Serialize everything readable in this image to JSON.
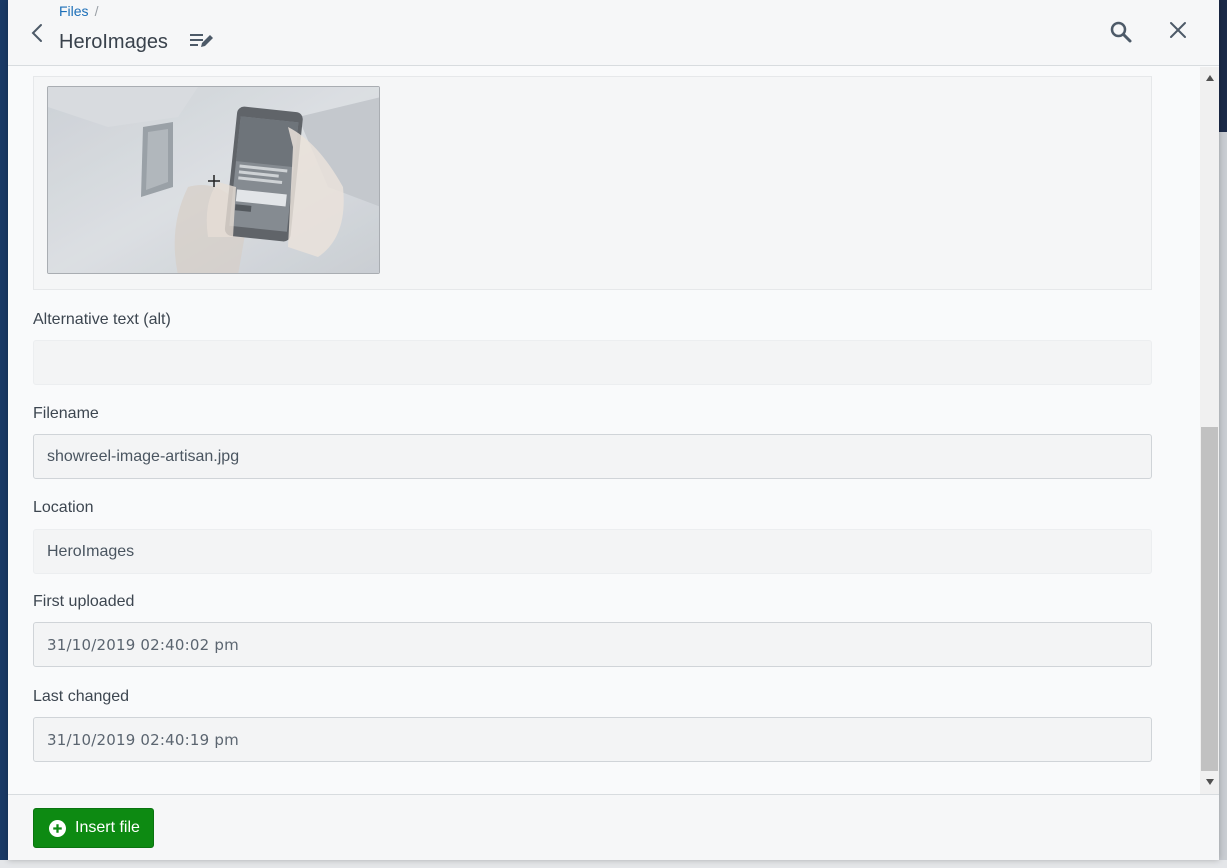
{
  "header": {
    "breadcrumb": "Files",
    "breadcrumb_separator": "/",
    "title": "HeroImages"
  },
  "preview": {
    "image_alt": "showreel-image-artisan.jpg preview"
  },
  "fields": {
    "alt": {
      "label": "Alternative text (alt)",
      "value": ""
    },
    "filename": {
      "label": "Filename",
      "value": "showreel-image-artisan.jpg"
    },
    "location": {
      "label": "Location",
      "value": "HeroImages"
    },
    "first_uploaded": {
      "label": "First uploaded",
      "value": "31/10/2019 02:40:02 pm"
    },
    "last_changed": {
      "label": "Last changed",
      "value": "31/10/2019 02:40:19 pm"
    }
  },
  "footer": {
    "insert_label": "Insert file"
  },
  "colors": {
    "accent": "#1c6fb8",
    "primary_button": "#0d8a12"
  }
}
